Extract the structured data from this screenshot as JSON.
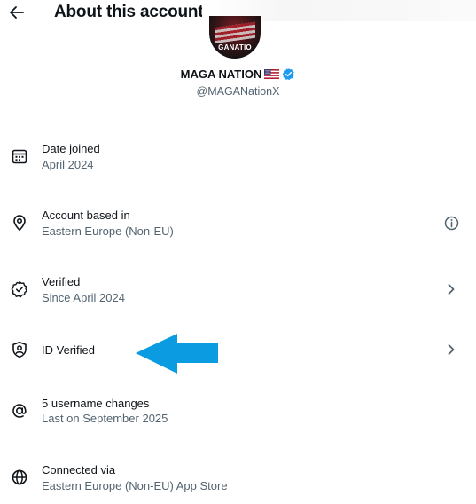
{
  "header": {
    "title": "About this account",
    "back_icon": "arrow-left-icon"
  },
  "profile": {
    "avatar_text": "GANATIO",
    "display_name": "MAGA NATION",
    "flag_icon": "us-flag-icon",
    "verified_icon": "verified-badge-icon",
    "verified_color": "#1d9bf0",
    "handle": "@MAGANationX"
  },
  "rows": [
    {
      "icon": "calendar-icon",
      "label": "Date joined",
      "sub": "April 2024",
      "trailing": null
    },
    {
      "icon": "location-pin-icon",
      "label": "Account based in",
      "sub": "Eastern Europe (Non-EU)",
      "trailing": "info-icon"
    },
    {
      "icon": "verified-check-icon",
      "label": "Verified",
      "sub": "Since April 2024",
      "trailing": "chevron-right-icon"
    },
    {
      "icon": "id-shield-icon",
      "label": "ID Verified",
      "sub": "",
      "trailing": "chevron-right-icon"
    },
    {
      "icon": "at-sign-icon",
      "label": "5 username changes",
      "sub": "Last on September 2025",
      "trailing": null
    },
    {
      "icon": "globe-icon",
      "label": "Connected via",
      "sub": "Eastern Europe (Non-EU) App Store",
      "trailing": null
    }
  ],
  "annotation": {
    "icon": "blue-arrow-left-icon",
    "color": "#0a9be0"
  },
  "colors": {
    "text_primary": "#0f1419",
    "text_secondary": "#536471"
  }
}
